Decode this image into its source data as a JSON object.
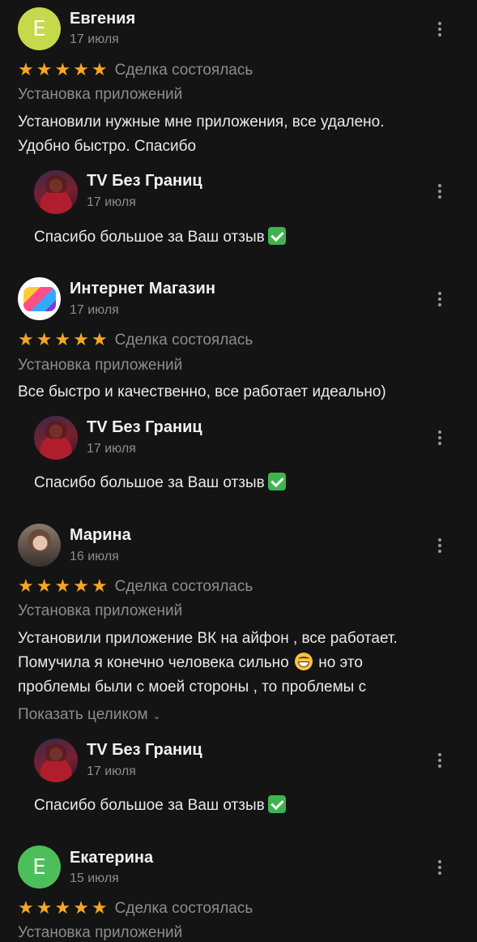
{
  "reviews": [
    {
      "author": "Евгения",
      "initial": "Е",
      "avatar_color": "#c5d94a",
      "date": "17 июля",
      "rating": 5,
      "deal_status": "Сделка состоялась",
      "category": "Установка приложений",
      "text_lines": [
        "Установили нужные мне приложения, все удалено.",
        "Удобно быстро. Спасибо"
      ],
      "reply": {
        "author": "TV Без Границ",
        "date": "17 июля",
        "text": "Спасибо большое за Ваш отзыв"
      }
    },
    {
      "author": "Интернет Магазин",
      "date": "17 июля",
      "rating": 5,
      "deal_status": "Сделка состоялась",
      "category": "Установка приложений",
      "text_lines": [
        "Все быстро и качественно, все работает идеально)"
      ],
      "reply": {
        "author": "TV Без Границ",
        "date": "17 июля",
        "text": "Спасибо большое за Ваш отзыв"
      }
    },
    {
      "author": "Марина",
      "date": "16 июля",
      "rating": 5,
      "deal_status": "Сделка состоялась",
      "category": "Установка приложений",
      "text_lines": [
        "Установили приложение ВК на айфон , все работает.",
        "Помучила я конечно человека сильно",
        "но это",
        "проблемы были с моей стороны , то проблемы с"
      ],
      "show_all": "Показать целиком",
      "reply": {
        "author": "TV Без Границ",
        "date": "17 июля",
        "text": "Спасибо большое за Ваш отзыв"
      }
    },
    {
      "author": "Екатерина",
      "initial": "Е",
      "avatar_color": "#4cbf5a",
      "date": "15 июля",
      "rating": 5,
      "deal_status": "Сделка состоялась",
      "category": "Установка приложений"
    }
  ],
  "icons": {
    "star": "star-icon",
    "more": "more-vertical-icon",
    "check": "check-mark-emoji",
    "grin": "grinning-face-emoji",
    "chevron": "chevron-down-icon"
  },
  "colors": {
    "background": "#141414",
    "star": "#f5a623",
    "muted_text": "#8d8d8d"
  }
}
